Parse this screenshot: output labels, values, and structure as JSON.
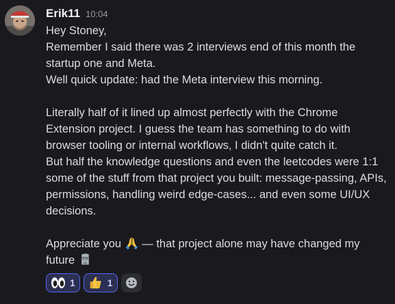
{
  "message": {
    "username": "Erik11",
    "timestamp": "10:04",
    "avatar_icon": "user-avatar-photo",
    "lines": [
      "Hey Stoney,",
      "Remember I said there was 2 interviews end of this month the",
      "startup one and Meta.",
      "Well quick update: had the Meta interview this morning.",
      "Literally half of it lined up almost perfectly with the Chrome",
      "Extension project. I guess the team has something to do with",
      "browser tooling or internal workflows, I didn't quite catch it.",
      "But half the knowledge questions and even the leetcodes were 1:1",
      "some of the stuff from that project you built: message-passing, APIs,",
      "permissions, handling weird edge-cases... and even some UI/UX",
      "decisions.",
      "Appreciate you",
      "— that project alone may have changed my",
      "future"
    ],
    "inline_emojis": [
      "folded-hands-emoji",
      "moai-emoji"
    ]
  },
  "reactions": [
    {
      "emoji": "eyes-emoji",
      "count": "1"
    },
    {
      "emoji": "thumbs-up-emoji",
      "count": "1"
    }
  ],
  "add_reaction_icon": "add-reaction-smiley-icon",
  "colors": {
    "background": "#1a1a1e",
    "text": "#dcdde1",
    "username": "#f2f3f5",
    "timestamp": "#949ba4",
    "reaction_border": "#5865f2",
    "reaction_bg": "#2b2f52"
  }
}
